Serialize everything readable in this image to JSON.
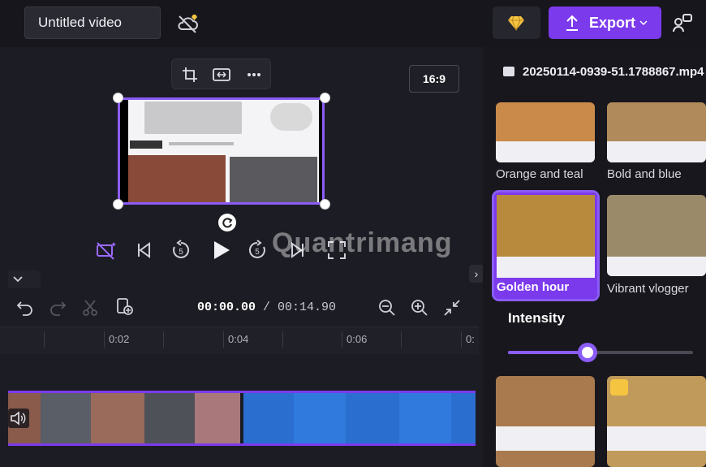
{
  "header": {
    "title_value": "Untitled video",
    "export_label": "Export",
    "accent": "#7c3aed"
  },
  "preview": {
    "aspect_ratio": "16:9",
    "toolbar_icons": [
      "crop-icon",
      "flip-icon",
      "more-icon"
    ]
  },
  "playback": {
    "current_time": "00:00.00",
    "separator": " / ",
    "total_time": "00:14.90"
  },
  "timeline": {
    "ticks": [
      "0:02",
      "0:04",
      "0:06",
      "0:"
    ]
  },
  "panel": {
    "file_name": "20250114-0939-51.1788867.mp4",
    "filters": [
      {
        "label": "Orange and teal",
        "tint": "#c98a4a"
      },
      {
        "label": "Bold and blue",
        "tint": "#b08a5a"
      },
      {
        "label": "Golden hour",
        "tint": "#b88a3e",
        "selected": true
      },
      {
        "label": "Vibrant vlogger",
        "tint": "#9a8a6a"
      }
    ],
    "intensity_label": "Intensity",
    "intensity_value": 0.43
  },
  "watermark": "Quantrimang"
}
